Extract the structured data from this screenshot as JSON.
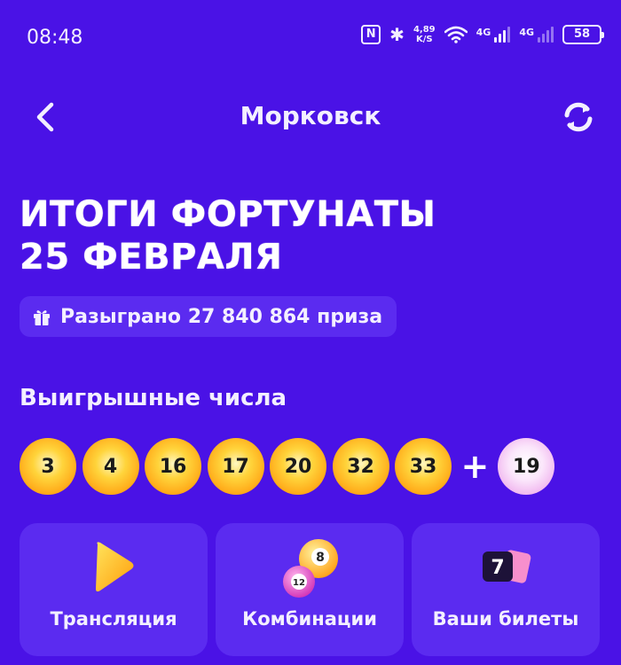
{
  "status_bar": {
    "time": "08:48",
    "speed_value": "4,89",
    "speed_unit": "K/S",
    "network1": "4G",
    "network2": "4G",
    "battery": "58"
  },
  "header": {
    "title": "Морковск"
  },
  "results": {
    "title_line1": "ИТОГИ ФОРТУНАТЫ",
    "title_line2": "25 ФЕВРАЛЯ",
    "prizes_text": "Разыграно 27 840 864 приза"
  },
  "winning_numbers": {
    "heading": "Выигрышные числа",
    "numbers": [
      "3",
      "4",
      "16",
      "17",
      "20",
      "32",
      "33"
    ],
    "plus": "+",
    "bonus": "19"
  },
  "actions": [
    {
      "label": "Трансляция",
      "icon": "play-icon"
    },
    {
      "label": "Комбинации",
      "icon": "lottery-balls-icon"
    },
    {
      "label": "Ваши билеты",
      "icon": "ticket-icon",
      "icon_text": "7"
    }
  ],
  "colors": {
    "background": "#4a12e6",
    "card": "#5b2bf0",
    "ball_yellow": "#ffc21a",
    "ball_pink": "#f1b7ef"
  }
}
